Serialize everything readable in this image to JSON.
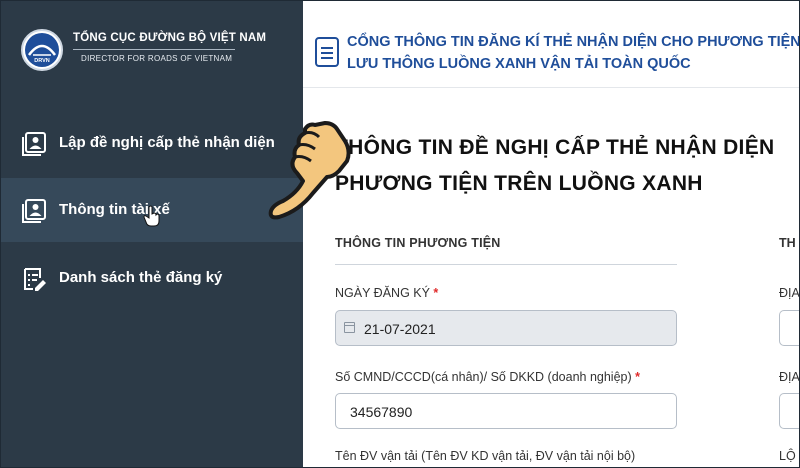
{
  "sidebar": {
    "logo_text": "DRVN",
    "org_name": "TỔNG CỤC ĐƯỜNG BỘ VIỆT NAM",
    "org_sub": "DIRECTOR FOR ROADS OF VIETNAM",
    "items": [
      {
        "label": "Lập đề nghị cấp thẻ nhận diện",
        "icon": "id-card-icon",
        "active": false
      },
      {
        "label": "Thông tin tài xế",
        "icon": "driver-card-icon",
        "active": true
      },
      {
        "label": "Danh sách thẻ đăng ký",
        "icon": "list-edit-icon",
        "active": false
      }
    ]
  },
  "header": {
    "portal_title": "CỔNG THÔNG TIN ĐĂNG KÍ THẺ NHẬN DIỆN CHO PHƯƠNG TIỆN LƯU THÔNG LUỒNG XANH VẬN TẢI TOÀN QUỐC"
  },
  "main": {
    "page_title": "THÔNG TIN ĐỀ NGHỊ CẤP THẺ NHẬN DIỆN PHƯƠNG TIỆN TRÊN LUỒNG XANH",
    "section_vehicle": "THÔNG TIN PHƯƠNG TIỆN",
    "section_right": "TH",
    "fields": {
      "reg_date_label": "NGÀY ĐĂNG KÝ",
      "reg_date_value": "21-07-2021",
      "id_label": "Số CMND/CCCD(cá nhân)/ Số DKKD (doanh nghiệp)",
      "id_value": "34567890",
      "transport_label": "Tên ĐV vận tải (Tên ĐV KD vận tải, ĐV vận tải nội bộ)",
      "required_mark": "*"
    },
    "right_labels": [
      "ĐỊA",
      "ĐỊA",
      "LỘ"
    ]
  },
  "colors": {
    "sidebar_bg": "#2c3a47",
    "sidebar_active": "#36495a",
    "accent_blue": "#1f4e9a",
    "required_red": "#e02b2b"
  }
}
